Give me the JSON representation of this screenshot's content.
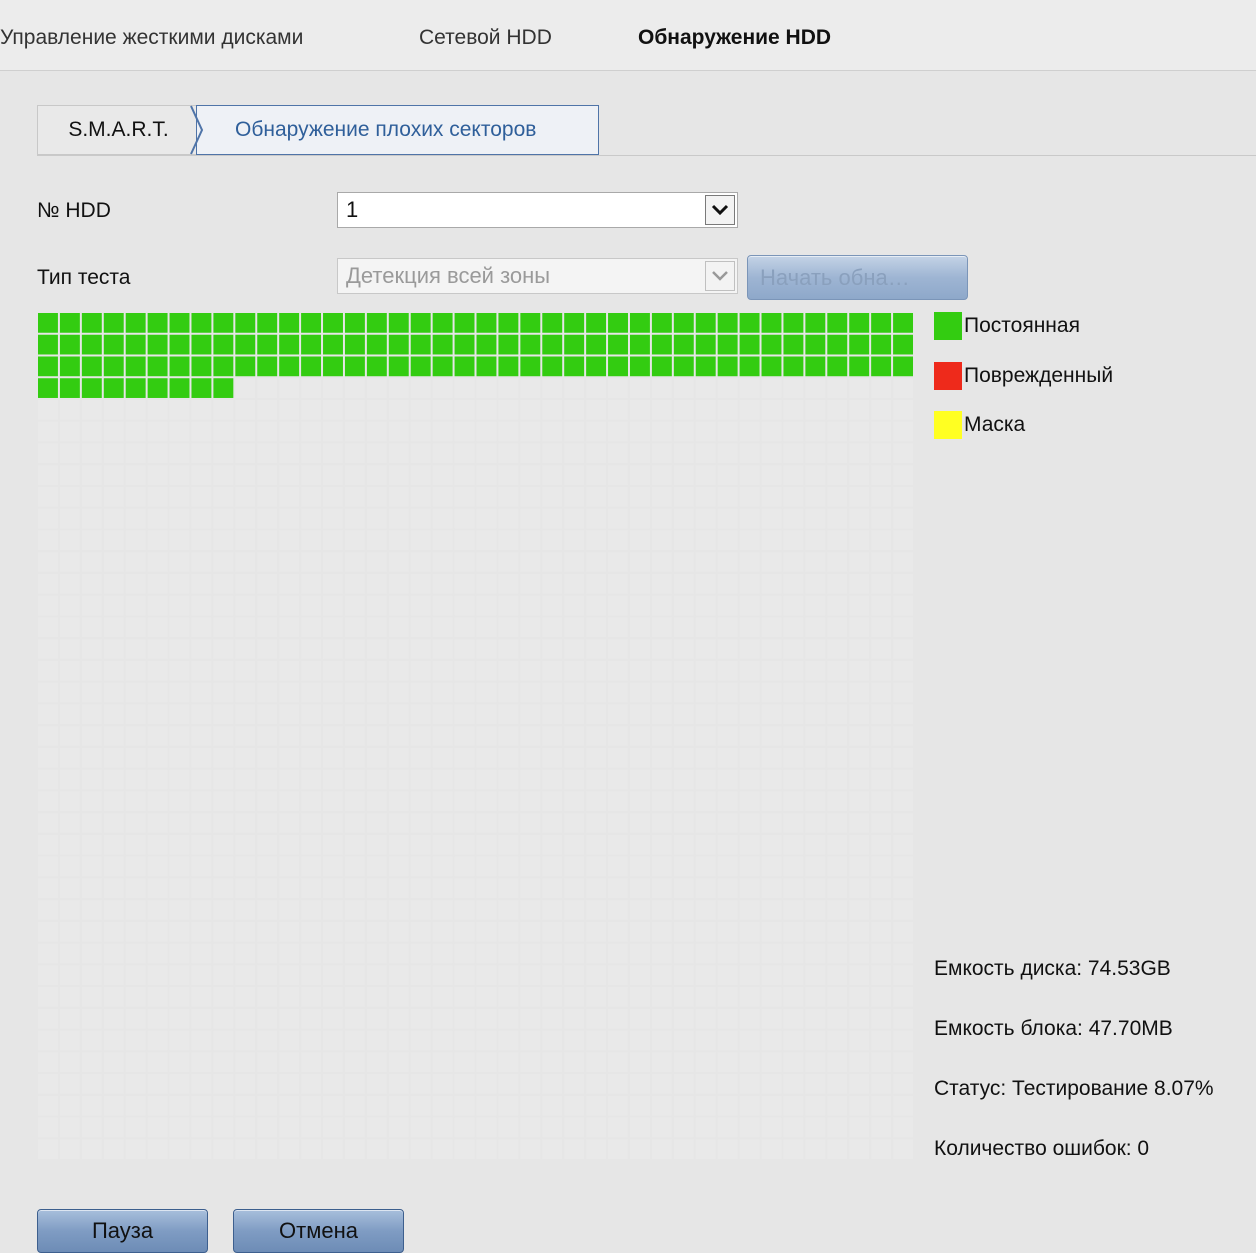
{
  "top_tabs": [
    {
      "label": "Управление жесткими дисками",
      "active": false
    },
    {
      "label": "Сетевой HDD",
      "active": false
    },
    {
      "label": "Обнаружение HDD",
      "active": true
    }
  ],
  "sub_tabs": [
    {
      "label": "S.M.A.R.T.",
      "active": false
    },
    {
      "label": "Обнаружение плохих секторов",
      "active": true
    }
  ],
  "form": {
    "hdd_label": "№ HDD",
    "hdd_value": "1",
    "test_type_label": "Тип теста",
    "test_type_value": "Детекция всей зоны",
    "start_button": "Начать обна…"
  },
  "legend": [
    {
      "label": "Постоянная",
      "color": "#33cc11"
    },
    {
      "label": "Поврежденный",
      "color": "#ee2a1b"
    },
    {
      "label": "Маска",
      "color": "#ffff22"
    }
  ],
  "info": {
    "disk_capacity": "Емкость диска: 74.53GB",
    "block_capacity": "Емкость блока: 47.70MB",
    "status": "Статус: Тестирование 8.07%",
    "error_count": "Количество ошибок: 0"
  },
  "grid": {
    "columns": 40,
    "rows": 39,
    "tested_blocks": 129,
    "tested_color": "#33cc11",
    "empty_color": "#e9e9e9"
  },
  "buttons": {
    "pause": "Пауза",
    "cancel": "Отмена"
  }
}
